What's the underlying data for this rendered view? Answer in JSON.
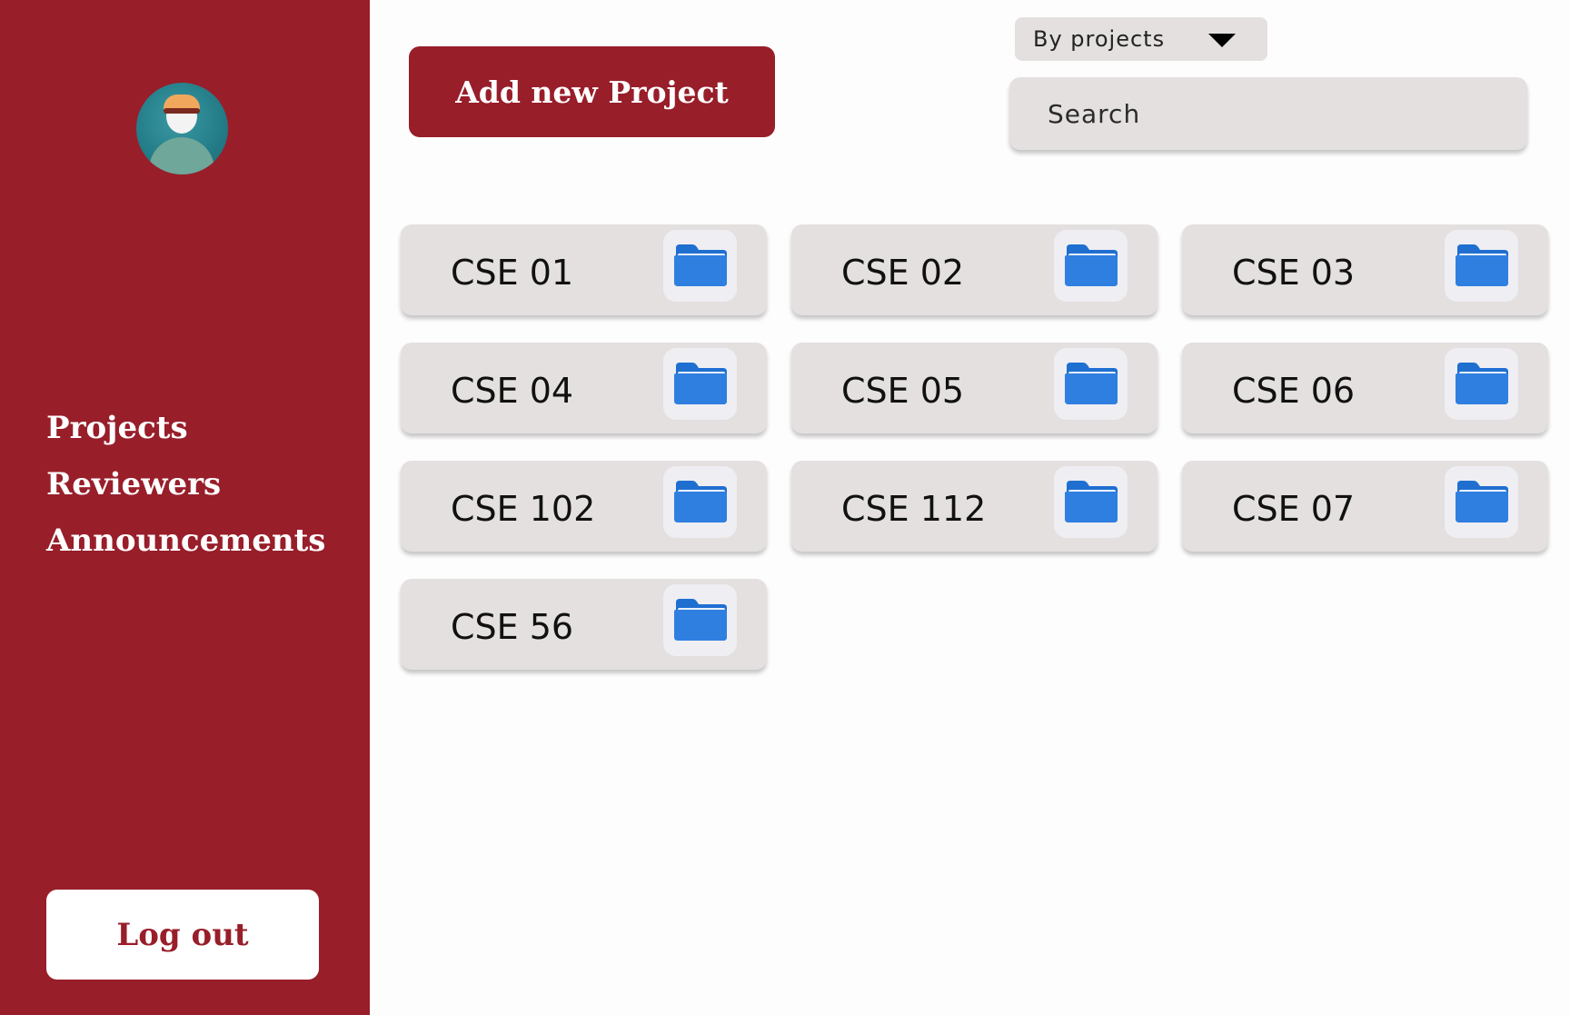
{
  "sidebar": {
    "avatar_alt": "",
    "nav": [
      {
        "label": "Projects"
      },
      {
        "label": "Reviewers"
      },
      {
        "label": "Announcements"
      }
    ],
    "logout_label": "Log out"
  },
  "header": {
    "add_button_label": "Add new Project",
    "filter": {
      "selected": "By projects"
    },
    "search": {
      "placeholder": "Search",
      "value": ""
    }
  },
  "projects": [
    {
      "name": "CSE 01",
      "icon": "folder-icon"
    },
    {
      "name": "CSE 02",
      "icon": "folder-icon"
    },
    {
      "name": "CSE 03",
      "icon": "folder-icon"
    },
    {
      "name": "CSE 04",
      "icon": "folder-icon"
    },
    {
      "name": "CSE 05",
      "icon": "folder-icon"
    },
    {
      "name": "CSE 06",
      "icon": "folder-icon"
    },
    {
      "name": "CSE 102",
      "icon": "folder-icon"
    },
    {
      "name": "CSE 112",
      "icon": "folder-icon"
    },
    {
      "name": "CSE 07",
      "icon": "folder-icon"
    },
    {
      "name": "CSE 56",
      "icon": "folder-icon"
    }
  ],
  "colors": {
    "brand": "#981e2a",
    "card": "#e4e0e0",
    "folder": "#2f7fe0"
  }
}
